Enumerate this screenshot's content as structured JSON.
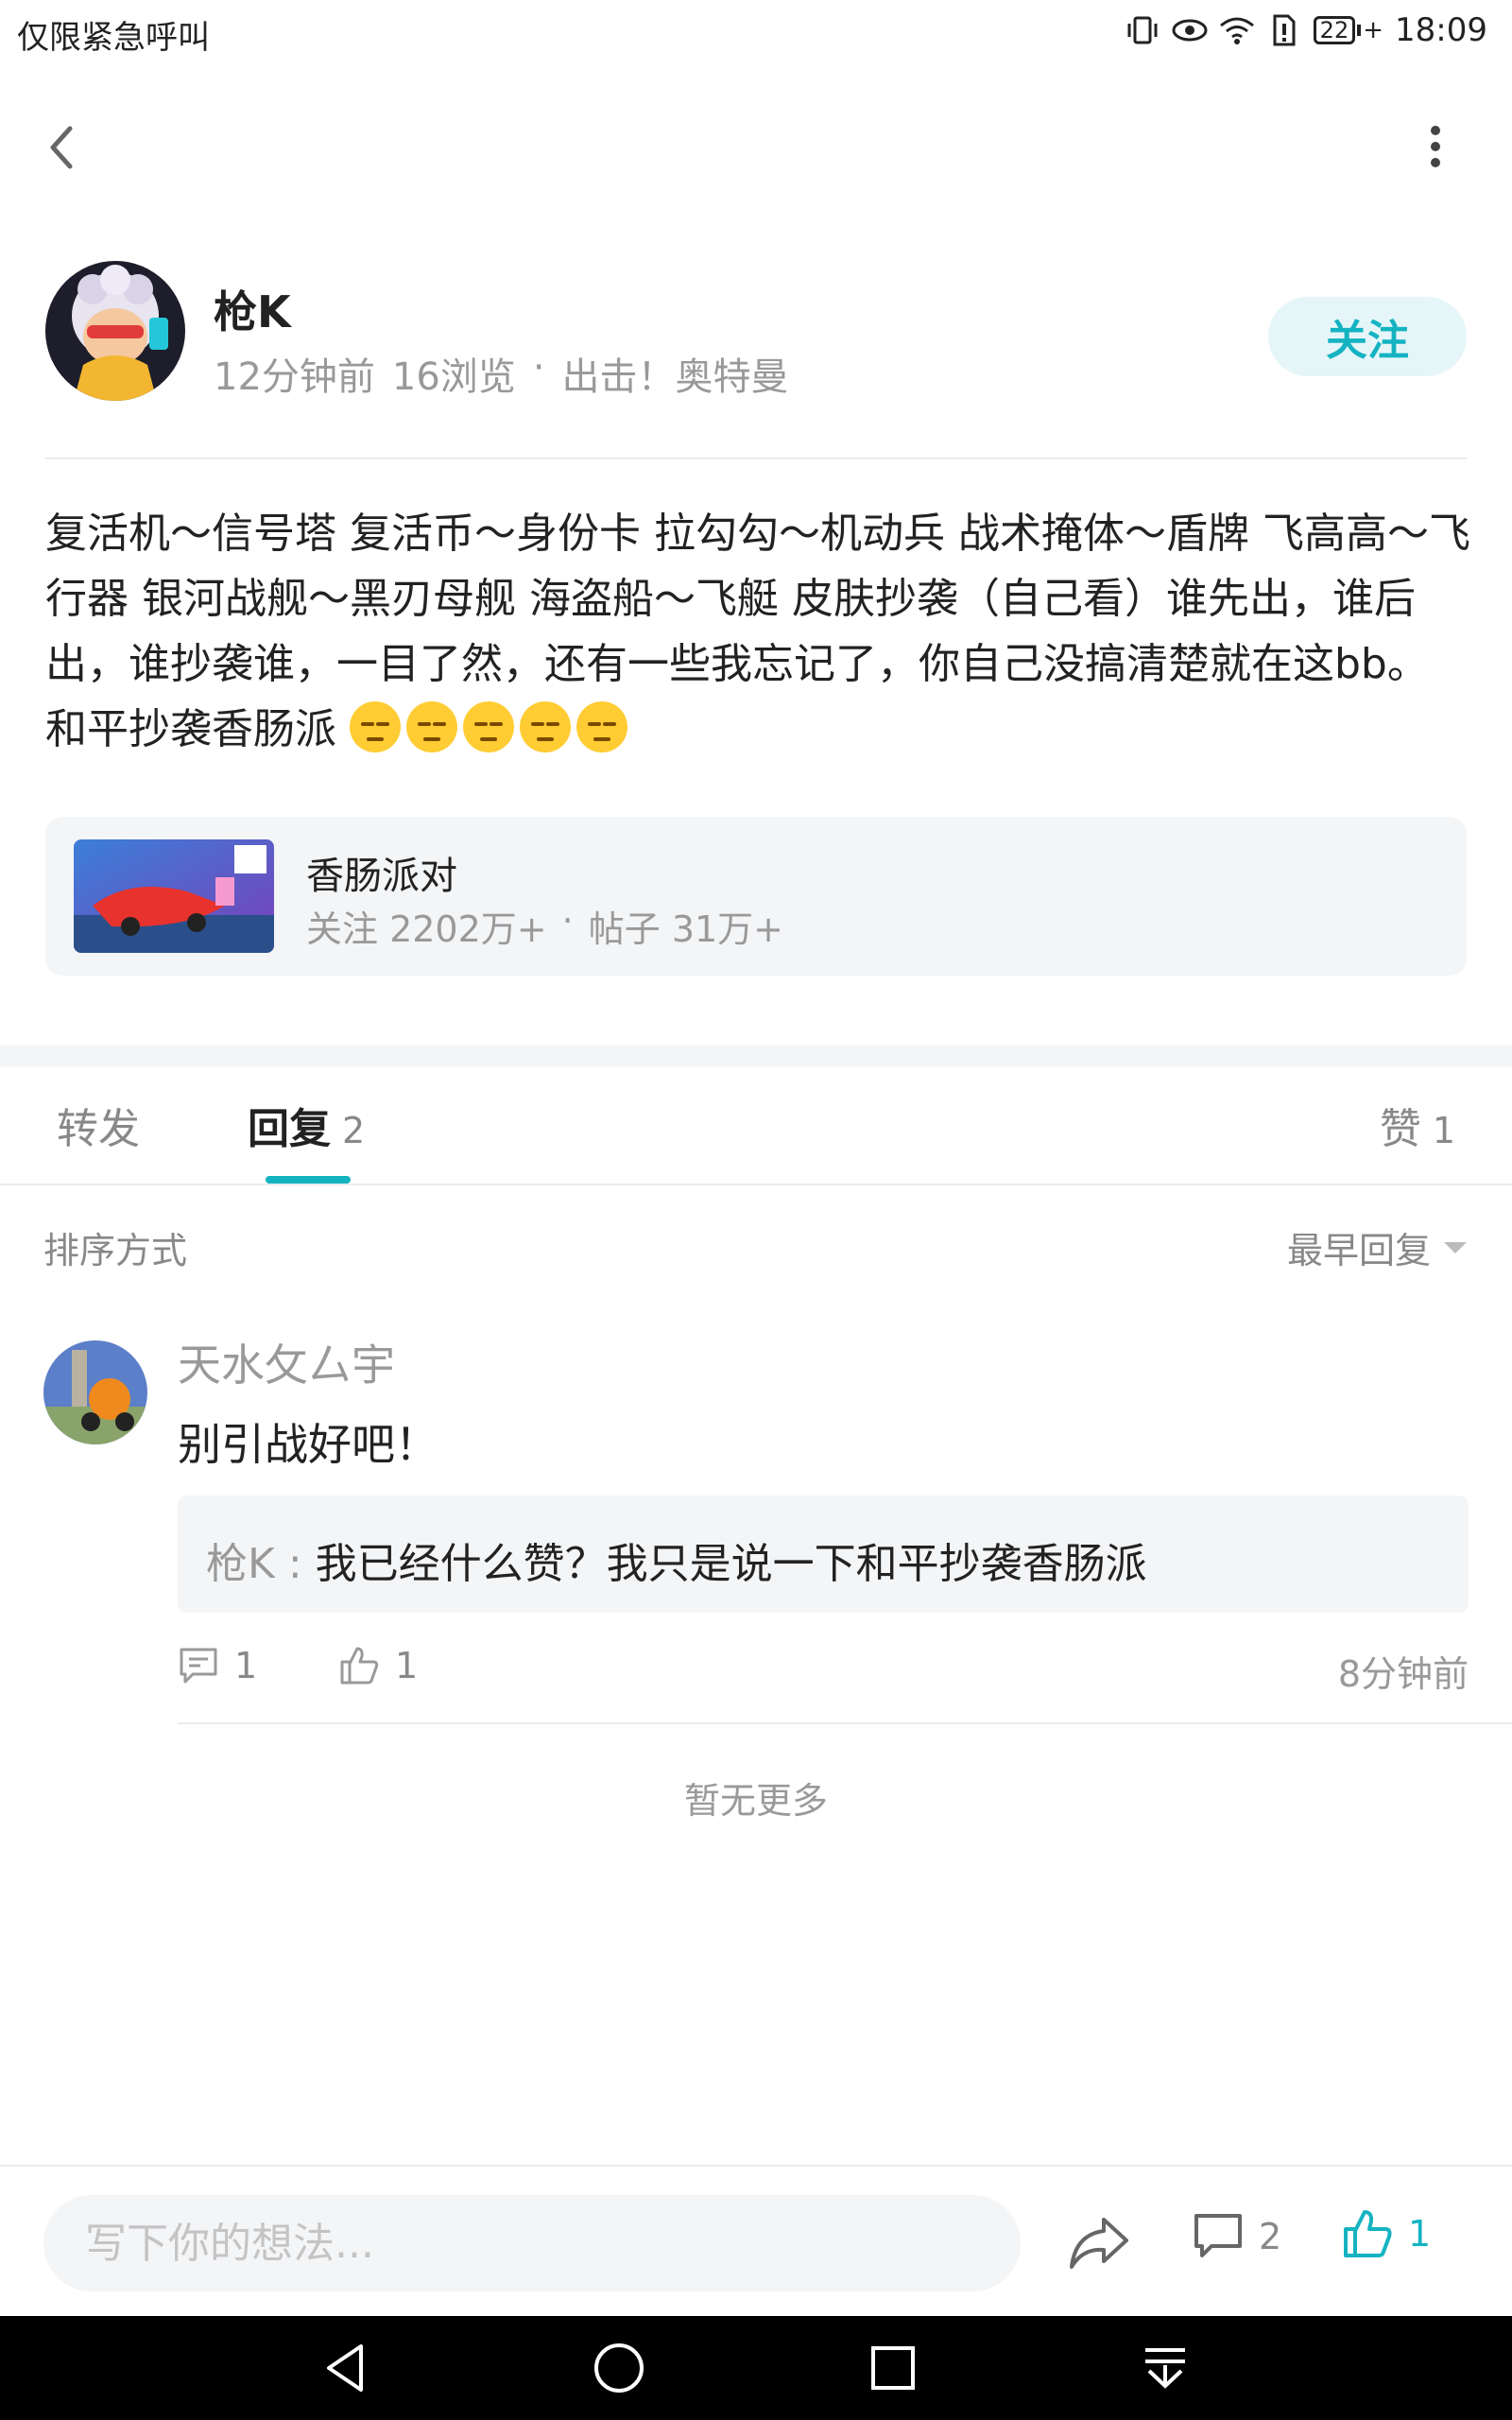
{
  "status_bar": {
    "left_text": "仅限紧急呼叫",
    "battery": "22",
    "time": "18:09"
  },
  "author": {
    "name": "枪K",
    "time_ago": "12分钟前",
    "views": "16浏览",
    "separator": "·",
    "topic": "出击！奥特曼",
    "follow_label": "关注"
  },
  "post": {
    "body": "复活机～信号塔 复活币～身份卡 拉勾勾～机动兵 战术掩体～盾牌 飞高高～飞行器 银河战舰～黑刃母舰 海盗船～飞艇 皮肤抄袭（自己看）谁先出，谁后出，谁抄袭谁，一目了然，还有一些我忘记了，你自己没搞清楚就在这bb。 和平抄袭香肠派 "
  },
  "game_card": {
    "name": "香肠派对",
    "followers": "关注 2202万+",
    "separator": "·",
    "posts": "帖子 31万+"
  },
  "tabs": {
    "repost": "转发",
    "reply": "回复",
    "reply_count": "2",
    "like": "赞",
    "like_count": "1"
  },
  "sort": {
    "label": "排序方式",
    "selected": "最早回复"
  },
  "reply": {
    "user": "天水攵厶宇",
    "text": "别引战好吧！",
    "quote_author": "枪K :",
    "quote_text": "我已经什么赞？我只是说一下和平抄袭香肠派",
    "comment_count": "1",
    "like_count": "1",
    "time": "8分钟前"
  },
  "no_more": "暂无更多",
  "bottom_bar": {
    "input_placeholder": "写下你的想法...",
    "comment_count": "2",
    "like_count": "1"
  },
  "colors": {
    "accent": "#15b3c2",
    "follow_bg": "#e6f6f8",
    "card_bg": "#f4f5f7"
  }
}
